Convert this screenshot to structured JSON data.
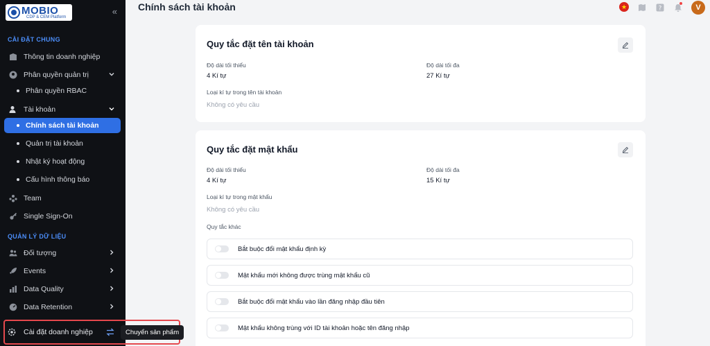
{
  "app": {
    "logo_text": "MOBIO",
    "logo_sub": "CDP & CEM Platform"
  },
  "sidebar": {
    "section_general": "CÀI ĐẶT CHUNG",
    "section_data": "QUẢN LÝ DỮ LIỆU",
    "items": [
      {
        "label": "Thông tin doanh nghiệp",
        "icon": "building-icon"
      },
      {
        "label": "Phân quyền quản trị",
        "icon": "shield-icon"
      },
      {
        "label": "Phân quyền RBAC"
      },
      {
        "label": "Tài khoản",
        "icon": "user-icon"
      },
      {
        "label": "Chính sách tài khoản"
      },
      {
        "label": "Quản trị tài khoản"
      },
      {
        "label": "Nhật ký hoạt động"
      },
      {
        "label": "Cấu hình thông báo"
      },
      {
        "label": "Team",
        "icon": "team-icon"
      },
      {
        "label": "Single Sign-On",
        "icon": "key-icon"
      },
      {
        "label": "Đối tượng",
        "icon": "users-icon"
      },
      {
        "label": "Events",
        "icon": "rocket-icon"
      },
      {
        "label": "Data Quality",
        "icon": "chart-icon"
      },
      {
        "label": "Data Retention",
        "icon": "gauge-icon"
      }
    ],
    "bottom_label": "Cài đặt doanh nghiệp",
    "tooltip": "Chuyển sản phẩm"
  },
  "header": {
    "title": "Chính sách tài khoản",
    "avatar_letter": "V",
    "flag_star": "★"
  },
  "account_rules": {
    "title": "Quy tắc đặt tên tài khoản",
    "min_label": "Độ dài tối thiểu",
    "min_value": "4 Kí tự",
    "max_label": "Độ dài tối đa",
    "max_value": "27 Kí tự",
    "chars_label": "Loại kí tự trong tên tài khoản",
    "chars_value": "Không có yêu cầu"
  },
  "password_rules": {
    "title": "Quy tắc đặt mật khẩu",
    "min_label": "Độ dài tối thiểu",
    "min_value": "4 Kí tự",
    "max_label": "Độ dài tối đa",
    "max_value": "15 Kí tự",
    "chars_label": "Loại kí tự trong mật khẩu",
    "chars_value": "Không có yêu cầu",
    "other_label": "Quy tắc khác",
    "rules": [
      {
        "label": "Bắt buộc đổi mật khẩu định kỳ",
        "enabled": false
      },
      {
        "label": "Mật khẩu mới không được trùng mật khẩu cũ",
        "enabled": false
      },
      {
        "label": "Bắt buộc đổi mật khẩu vào lần đăng nhập đầu tiên",
        "enabled": false
      },
      {
        "label": "Mật khẩu không trùng với ID tài khoản hoặc tên đăng nhập",
        "enabled": false
      }
    ]
  },
  "colors": {
    "accent": "#2f6fe4",
    "sidebar_bg": "#0f1115",
    "highlight_border": "#e5484d",
    "avatar": "#c86a1b"
  }
}
